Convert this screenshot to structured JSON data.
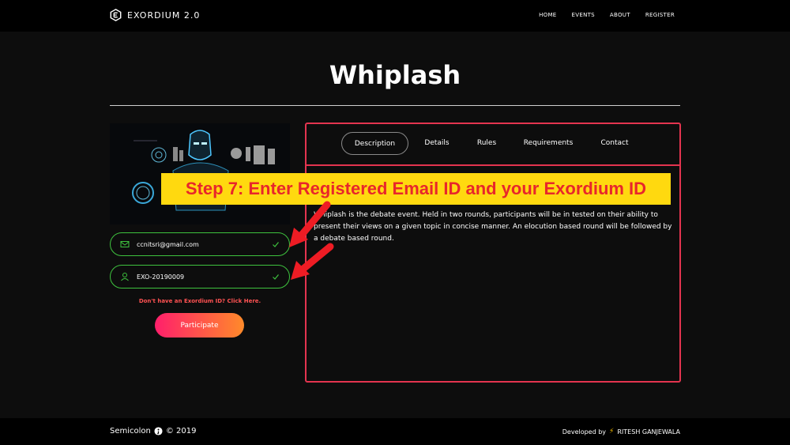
{
  "brand": {
    "name": "EXORDIUM 2.0",
    "logo_icon": "hexagon-e-logo-icon"
  },
  "nav": {
    "items": [
      "HOME",
      "EVENTS",
      "ABOUT",
      "REGISTER"
    ]
  },
  "event": {
    "title": "Whiplash",
    "image_icon": "iron-man-hud-image"
  },
  "form": {
    "email_value": "ccnitsri@gmail.com",
    "email_icon": "envelope-icon",
    "id_value": "EXO-20190009",
    "id_icon": "user-icon",
    "valid_color": "#3ec23e",
    "hint": "Don't have an Exordium ID? Click Here.",
    "submit_label": "Participate"
  },
  "tabs": [
    {
      "label": "Description",
      "active": true
    },
    {
      "label": "Details",
      "active": false
    },
    {
      "label": "Rules",
      "active": false
    },
    {
      "label": "Requirements",
      "active": false
    },
    {
      "label": "Contact",
      "active": false
    }
  ],
  "description": "Whiplash is the debate event. Held in two rounds, participants will be in tested on their ability to present their views on a given topic in concise manner. An elocution based round will be followed by a debate based round.",
  "overlay": {
    "step_text": "Step 7: Enter Registered Email ID and your Exordium ID",
    "banner_color": "#ffd90f",
    "text_color": "#e8262b"
  },
  "footer": {
    "left_prefix": "Semicolon",
    "left_suffix": "© 2019",
    "right_prefix": "Developed by",
    "right_name": "RITESH GANJEWALA"
  },
  "colors": {
    "accent": "#e3344f",
    "button_start": "#ff1f6b",
    "button_end": "#ff8a2a"
  }
}
